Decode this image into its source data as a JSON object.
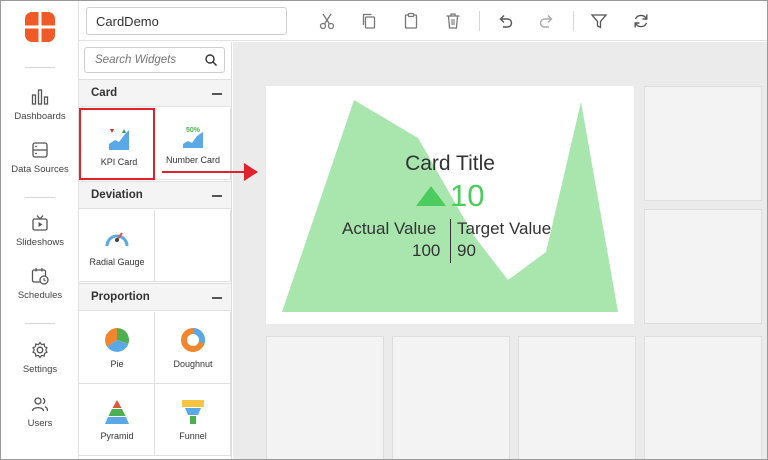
{
  "toolbar": {
    "dashboard_name": "CardDemo",
    "icons": [
      "cut-icon",
      "copy-icon",
      "paste-icon",
      "delete-icon",
      "undo-icon",
      "redo-icon",
      "filter-icon",
      "refresh-icon"
    ]
  },
  "nav": {
    "items": [
      {
        "label": "Dashboards",
        "icon": "dashboards-icon"
      },
      {
        "label": "Data Sources",
        "icon": "data-sources-icon"
      },
      {
        "label": "Slideshows",
        "icon": "slideshows-icon"
      },
      {
        "label": "Schedules",
        "icon": "schedules-icon"
      },
      {
        "label": "Settings",
        "icon": "settings-icon"
      },
      {
        "label": "Users",
        "icon": "users-icon"
      }
    ]
  },
  "panel": {
    "search_placeholder": "Search Widgets",
    "sections": [
      {
        "title": "Card",
        "widgets": [
          {
            "label": "KPI Card",
            "badge": ""
          },
          {
            "label": "Number Card",
            "badge": "50%"
          }
        ]
      },
      {
        "title": "Deviation",
        "widgets": [
          {
            "label": "Radial Gauge"
          }
        ]
      },
      {
        "title": "Proportion",
        "widgets": [
          {
            "label": "Pie"
          },
          {
            "label": "Doughnut"
          },
          {
            "label": "Pyramid"
          },
          {
            "label": "Funnel"
          }
        ]
      }
    ]
  },
  "card": {
    "title": "Card Title",
    "kpi_value": "10",
    "actual_label": "Actual Value",
    "target_label": "Target Value",
    "actual_value": "100",
    "target_value": "90"
  },
  "colors": {
    "brand": "#f05a28",
    "kpi_green": "#4ccb5e",
    "area_fill": "#a8e6ae",
    "highlight_red": "#e0232a"
  }
}
